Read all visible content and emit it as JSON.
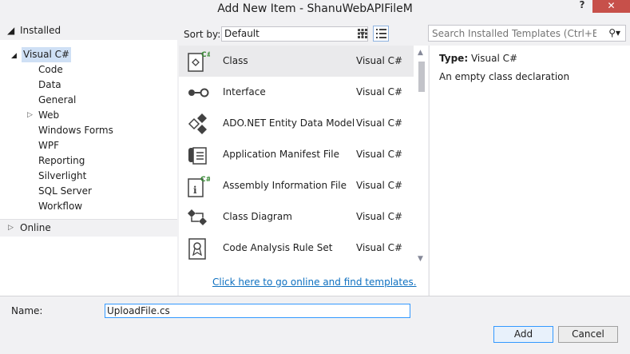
{
  "window": {
    "title": "Add New Item - ShanuWebAPIFileM",
    "help": "?",
    "close": "✕"
  },
  "categories": {
    "installed": "Installed",
    "visual_csharp": "Visual C#",
    "children": [
      "Code",
      "Data",
      "General",
      "Web",
      "Windows Forms",
      "WPF",
      "Reporting",
      "Silverlight",
      "SQL Server",
      "Workflow"
    ],
    "online": "Online"
  },
  "toolbar": {
    "sort_label": "Sort by:",
    "sort_value": "Default",
    "search_placeholder": "Search Installed Templates (Ctrl+E)"
  },
  "templates": [
    {
      "name": "Class",
      "language": "Visual C#",
      "icon": "class-icon"
    },
    {
      "name": "Interface",
      "language": "Visual C#",
      "icon": "interface-icon"
    },
    {
      "name": "ADO.NET Entity Data Model",
      "language": "Visual C#",
      "icon": "entity-model-icon"
    },
    {
      "name": "Application Manifest File",
      "language": "Visual C#",
      "icon": "manifest-icon"
    },
    {
      "name": "Assembly Information File",
      "language": "Visual C#",
      "icon": "assembly-info-icon"
    },
    {
      "name": "Class Diagram",
      "language": "Visual C#",
      "icon": "class-diagram-icon"
    },
    {
      "name": "Code Analysis Rule Set",
      "language": "Visual C#",
      "icon": "rule-set-icon"
    }
  ],
  "online_link": "Click here to go online and find templates.",
  "details": {
    "type_label": "Type:",
    "type_value": "Visual C#",
    "description": "An empty class declaration"
  },
  "name_field": {
    "label": "Name:",
    "value": "UploadFile.cs"
  },
  "buttons": {
    "add": "Add",
    "cancel": "Cancel"
  },
  "colors": {
    "accent": "#3399ff",
    "link": "#0e70c0",
    "close": "#c7504a",
    "selection": "#cfe0f5"
  }
}
